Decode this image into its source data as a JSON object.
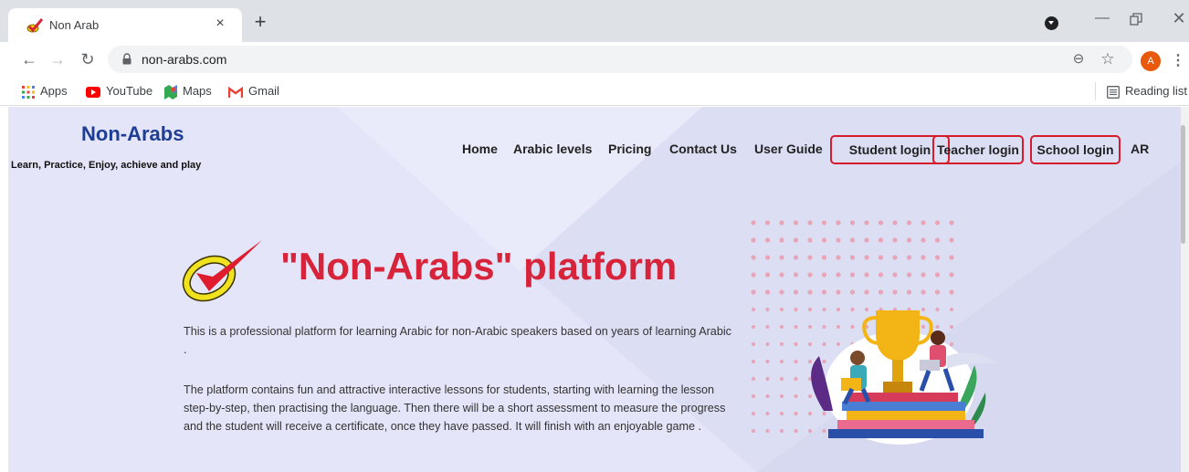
{
  "browser": {
    "tab_title": "Non Arab",
    "tab_close": "×",
    "new_tab": "+",
    "url": "non-arabs.com",
    "profile_initial": "A",
    "bookmarks": [
      {
        "label": "Apps",
        "icon": "apps-grid-icon"
      },
      {
        "label": "YouTube",
        "icon": "youtube-icon"
      },
      {
        "label": "Maps",
        "icon": "maps-icon"
      },
      {
        "label": "Gmail",
        "icon": "gmail-icon"
      }
    ],
    "reading_list": "Reading list"
  },
  "site": {
    "brand": "Non-Arabs",
    "tagline": "Learn, Practice, Enjoy, achieve and play",
    "nav": {
      "home": "Home",
      "levels": "Arabic levels",
      "pricing": "Pricing",
      "contact": "Contact Us",
      "guide": "User Guide",
      "student_login": "Student login",
      "teacher_login": "Teacher login",
      "school_login": "School login",
      "lang": "AR"
    },
    "hero_title": "\"Non-Arabs\" platform",
    "para1": "This is a professional platform for learning Arabic for non-Arabic speakers based on years of learning Arabic .",
    "para2": "The platform contains fun and attractive interactive lessons for students, starting with learning the lesson step-by-step, then practising the language. Then there will be a short assessment to measure the progress and the student will receive a certificate, once they have passed. It will finish with an enjoyable game ."
  },
  "colors": {
    "brand_blue": "#1d3e94",
    "hero_red": "#d7243a",
    "login_outline": "#d51b2c",
    "page_bg": "#e4e5f8"
  }
}
